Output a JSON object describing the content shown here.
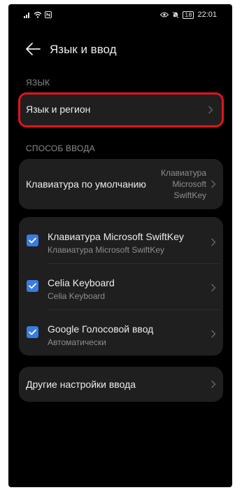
{
  "status_bar": {
    "time": "22:01",
    "battery": "18",
    "icons": [
      "signal-icon",
      "wifi-icon",
      "nfc-icon",
      "eye-icon",
      "mute-icon",
      "battery-icon"
    ]
  },
  "header": {
    "title": "Язык и ввод"
  },
  "sections": {
    "language_label": "ЯЗЫК",
    "input_method_label": "СПОСОБ ВВОДА"
  },
  "language_region": {
    "label": "Язык и регион"
  },
  "default_keyboard": {
    "label": "Клавиатура по умолчанию",
    "value_lines": [
      "Клавиатура",
      "Microsoft",
      "SwiftKey"
    ]
  },
  "keyboards": [
    {
      "title": "Клавиатура Microsoft SwiftKey",
      "subtitle": "Клавиатура Microsoft SwiftKey",
      "checked": true
    },
    {
      "title": "Celia Keyboard",
      "subtitle": "Celia Keyboard",
      "checked": true
    },
    {
      "title": "Google Голосовой ввод",
      "subtitle": "Автоматически",
      "checked": true
    }
  ],
  "other_settings": {
    "label": "Другие настройки ввода"
  },
  "colors": {
    "accent": "#3a7be0",
    "highlight": "#e4121c",
    "card": "#1f1f1f",
    "background": "#000000"
  }
}
